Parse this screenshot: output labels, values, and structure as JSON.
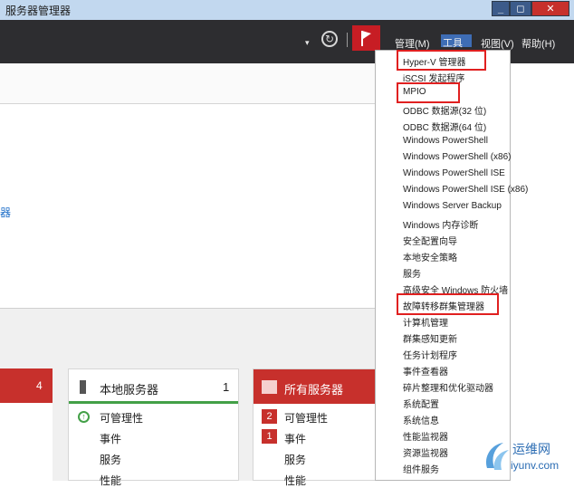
{
  "window": {
    "title": "服务器管理器",
    "min_label": "_",
    "max_label": "◻",
    "close_label": "✕"
  },
  "toolbar": {
    "dropdown_arrow": "▾",
    "refresh_icon": "refresh-icon",
    "flag_icon": "notification-flag-icon",
    "flag_color": "#c71d24",
    "menus": {
      "manage": "管理(M)",
      "tools": "工具(T)",
      "view": "视图(V)",
      "help": "帮助(H)"
    },
    "active_menu_color": "#3e6db5"
  },
  "left_link": "器",
  "tiles": {
    "roles": {
      "count": "4",
      "color": "#c7302c"
    },
    "local": {
      "title": "本地服务器",
      "count": "1",
      "rows": [
        "可管理性",
        "事件",
        "服务",
        "性能"
      ],
      "status_color": "#43a047"
    },
    "all": {
      "title": "所有服务器",
      "rows": [
        "可管理性",
        "事件",
        "服务",
        "性能"
      ],
      "badges": [
        "2",
        "1"
      ],
      "color": "#c7302c"
    }
  },
  "tools_menu": {
    "items": [
      "Hyper-V 管理器",
      "iSCSI 发起程序",
      "MPIO",
      "ODBC 数据源(32 位)",
      "ODBC 数据源(64 位)",
      "Windows PowerShell",
      "Windows PowerShell (x86)",
      "Windows PowerShell ISE",
      "Windows PowerShell ISE (x86)",
      "Windows Server Backup",
      "Windows 内存诊断",
      "安全配置向导",
      "本地安全策略",
      "服务",
      "高级安全 Windows 防火墙",
      "故障转移群集管理器",
      "计算机管理",
      "群集感知更新",
      "任务计划程序",
      "事件查看器",
      "碎片整理和优化驱动器",
      "系统配置",
      "系统信息",
      "性能监视器",
      "资源监视器",
      "组件服务"
    ],
    "highlighted": [
      "Hyper-V 管理器",
      "MPIO",
      "故障转移群集管理器"
    ],
    "highlight_color": "#e02020"
  },
  "watermark": {
    "name": "运维网",
    "url": "iyunv.com"
  }
}
